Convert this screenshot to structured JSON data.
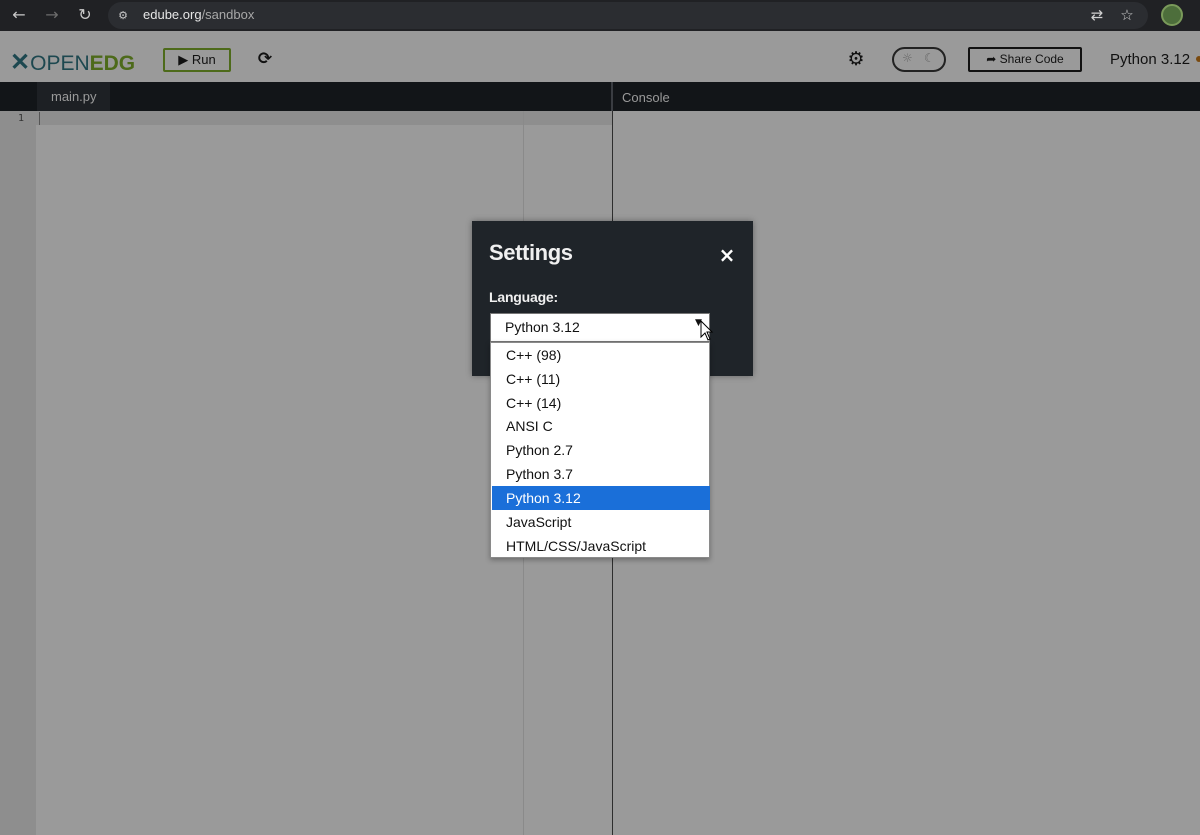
{
  "browser": {
    "url_host": "edube.org",
    "url_path": "/sandbox",
    "nav_icons": [
      "back-arrow-icon",
      "forward-arrow-icon",
      "reload-icon"
    ],
    "site_icon": "site-settings-icon"
  },
  "header": {
    "logo_open": "OPEN",
    "logo_edg": "EDG",
    "run_label": "▶ Run",
    "share_label": "Share Code",
    "current_language": "Python 3.12"
  },
  "editor": {
    "tab_label": "main.py",
    "line_number": "1"
  },
  "console": {
    "tab_label": "Console"
  },
  "settings": {
    "title": "Settings",
    "close": "×",
    "language_label": "Language:",
    "selected": "Python 3.12",
    "options": [
      "C++ (98)",
      "C++ (11)",
      "C++ (14)",
      "ANSI C",
      "Python 2.7",
      "Python 3.7",
      "Python 3.12",
      "JavaScript",
      "HTML/CSS/JavaScript"
    ],
    "selected_index": 6
  },
  "colors": {
    "accent_green": "#4d6a1a",
    "selection_blue": "#1a6fd9",
    "modal_bg": "#1f2429"
  }
}
